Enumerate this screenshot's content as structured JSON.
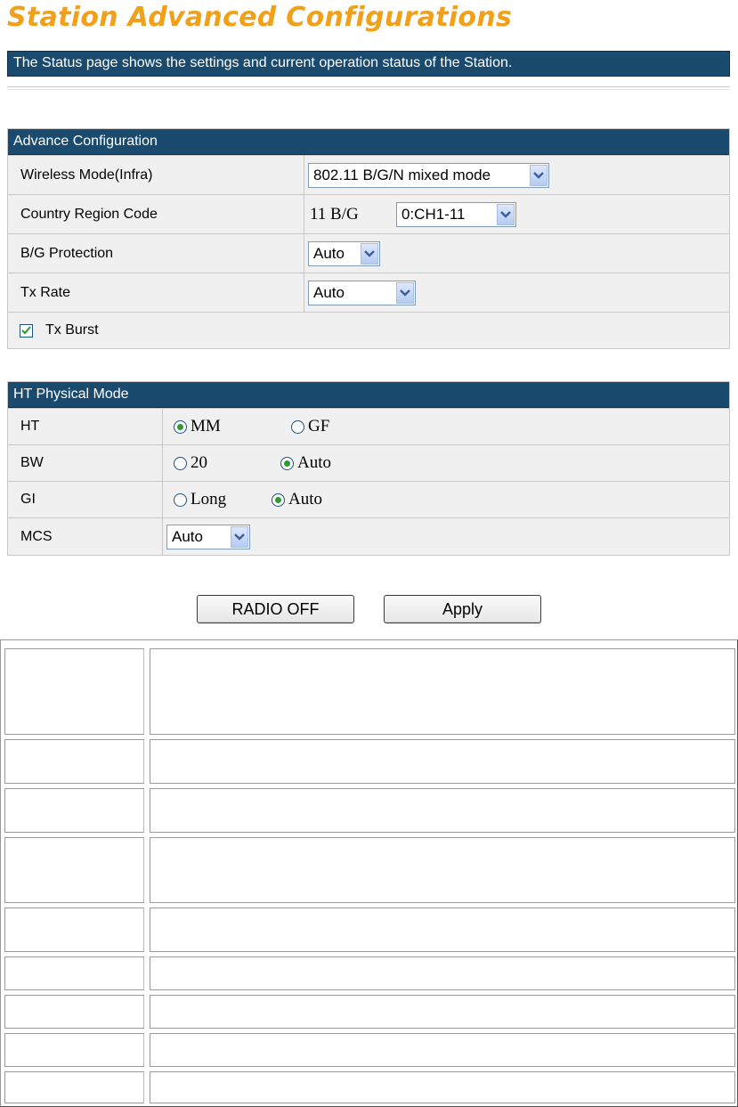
{
  "page": {
    "title": "Station Advanced Configurations",
    "description": "The Status page shows the settings and current operation status of the Station."
  },
  "advance": {
    "header": "Advance Configuration",
    "wireless_mode_label": "Wireless Mode(Infra)",
    "wireless_mode_value": "802.11 B/G/N mixed mode",
    "country_region_label": "Country Region Code",
    "country_band_text": "11 B/G",
    "country_channel_value": "0:CH1-11",
    "bg_protection_label": "B/G Protection",
    "bg_protection_value": "Auto",
    "tx_rate_label": "Tx Rate",
    "tx_rate_value": "Auto",
    "tx_burst_label": "Tx Burst",
    "tx_burst_checked": true
  },
  "ht": {
    "header": "HT Physical Mode",
    "ht_label": "HT",
    "ht_opt1": "MM",
    "ht_opt2": "GF",
    "ht_selected": "MM",
    "bw_label": "BW",
    "bw_opt1": "20",
    "bw_opt2": "Auto",
    "bw_selected": "Auto",
    "gi_label": "GI",
    "gi_opt1": "Long",
    "gi_opt2": "Auto",
    "gi_selected": "Auto",
    "mcs_label": "MCS",
    "mcs_value": "Auto"
  },
  "buttons": {
    "radio_off": "RADIO OFF",
    "apply": "Apply"
  },
  "colors": {
    "title": "#f0a019",
    "header_bar": "#1b4a6f",
    "panel_bg": "#f0f0f0",
    "radio_dot": "#2a9d2a"
  }
}
